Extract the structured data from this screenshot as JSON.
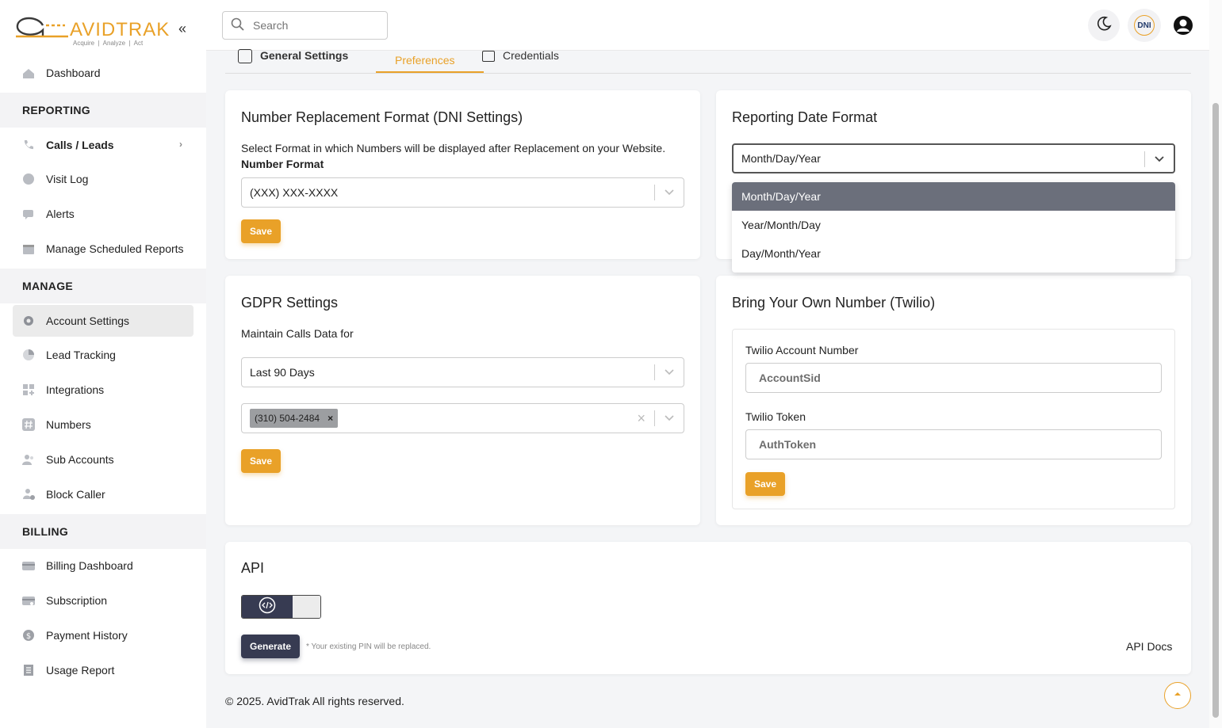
{
  "brand": {
    "name": "AVIDTRAK",
    "tagline": "Acquire  |  Analyze  |  Act"
  },
  "search": {
    "placeholder": "Search"
  },
  "header": {
    "dni_label": "DNI"
  },
  "sidebar": {
    "dashboard": "Dashboard",
    "reporting_title": "REPORTING",
    "calls_leads": "Calls / Leads",
    "visit_log": "Visit Log",
    "alerts": "Alerts",
    "scheduled_reports": "Manage Scheduled Reports",
    "manage_title": "MANAGE",
    "account_settings": "Account Settings",
    "lead_tracking": "Lead Tracking",
    "integrations": "Integrations",
    "numbers": "Numbers",
    "sub_accounts": "Sub Accounts",
    "block_caller": "Block Caller",
    "billing_title": "BILLING",
    "billing_dashboard": "Billing Dashboard",
    "subscription": "Subscription",
    "payment_history": "Payment History",
    "usage_report": "Usage Report"
  },
  "tabs": {
    "general": "General Settings",
    "preferences": "Preferences",
    "credentials": "Credentials"
  },
  "dni": {
    "title": "Number Replacement Format (DNI Settings)",
    "description": "Select Format in which Numbers will be displayed after Replacement on your Website.",
    "label": "Number Format",
    "value": "(XXX) XXX-XXXX",
    "save": "Save"
  },
  "date_format": {
    "title": "Reporting Date Format",
    "value": "Month/Day/Year",
    "options": [
      "Month/Day/Year",
      "Year/Month/Day",
      "Day/Month/Year"
    ]
  },
  "gdpr": {
    "title": "GDPR Settings",
    "label": "Maintain Calls Data for",
    "value": "Last 90 Days",
    "chip": "(310) 504-2484",
    "save": "Save"
  },
  "twilio": {
    "title": "Bring Your Own Number (Twilio)",
    "account_label": "Twilio Account Number",
    "account_placeholder": "AccountSid",
    "token_label": "Twilio Token",
    "token_placeholder": "AuthToken",
    "save": "Save"
  },
  "api": {
    "title": "API",
    "generate": "Generate",
    "note": "* Your existing PIN will be replaced.",
    "docs": "API Docs"
  },
  "footer": {
    "copyright": "© 2025. AvidTrak All rights reserved."
  },
  "colors": {
    "accent": "#e9a128",
    "navy": "#373b52",
    "selected_option": "#6b6f7b"
  }
}
